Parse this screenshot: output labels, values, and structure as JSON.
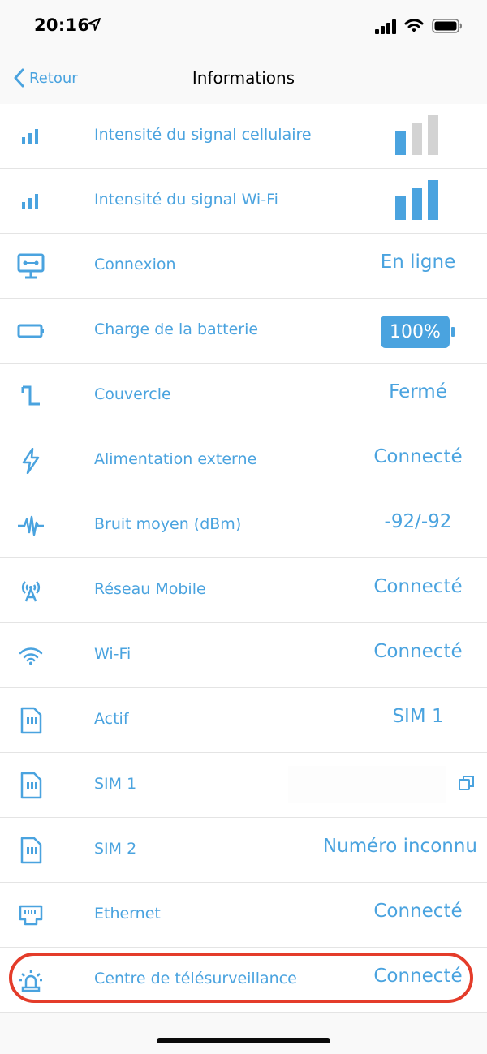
{
  "status_bar": {
    "time": "20:16"
  },
  "nav": {
    "back_label": "Retour",
    "title": "Informations"
  },
  "colors": {
    "accent": "#4aa3df",
    "inactive_bar": "#d3d3d3",
    "highlight": "#e43c2a"
  },
  "rows": [
    {
      "label": "Intensité du signal cellulaire",
      "icon": "signal-bars-icon",
      "value_level": 1,
      "value_max": 3
    },
    {
      "label": "Intensité du signal Wi-Fi",
      "icon": "signal-bars-icon",
      "value_level": 3,
      "value_max": 3
    },
    {
      "label": "Connexion",
      "icon": "network-monitor-icon",
      "value": "En ligne"
    },
    {
      "label": "Charge de la batterie",
      "icon": "battery-icon",
      "value": "100%"
    },
    {
      "label": "Couvercle",
      "icon": "lid-icon",
      "value": "Fermé"
    },
    {
      "label": "Alimentation externe",
      "icon": "lightning-icon",
      "value": "Connecté"
    },
    {
      "label": "Bruit moyen (dBm)",
      "icon": "waveform-icon",
      "value": "-92/-92"
    },
    {
      "label": "Réseau Mobile",
      "icon": "antenna-icon",
      "value": "Connecté"
    },
    {
      "label": "Wi-Fi",
      "icon": "wifi-icon",
      "value": "Connecté"
    },
    {
      "label": "Actif",
      "icon": "sim-card-icon",
      "value": "SIM 1"
    },
    {
      "label": "SIM 1",
      "icon": "sim-card-icon",
      "value": ""
    },
    {
      "label": "SIM 2",
      "icon": "sim-card-icon",
      "value": "Numéro inconnu"
    },
    {
      "label": "Ethernet",
      "icon": "ethernet-port-icon",
      "value": "Connecté"
    },
    {
      "label": "Centre de télésurveillance",
      "icon": "alarm-siren-icon",
      "value": "Connecté"
    }
  ]
}
